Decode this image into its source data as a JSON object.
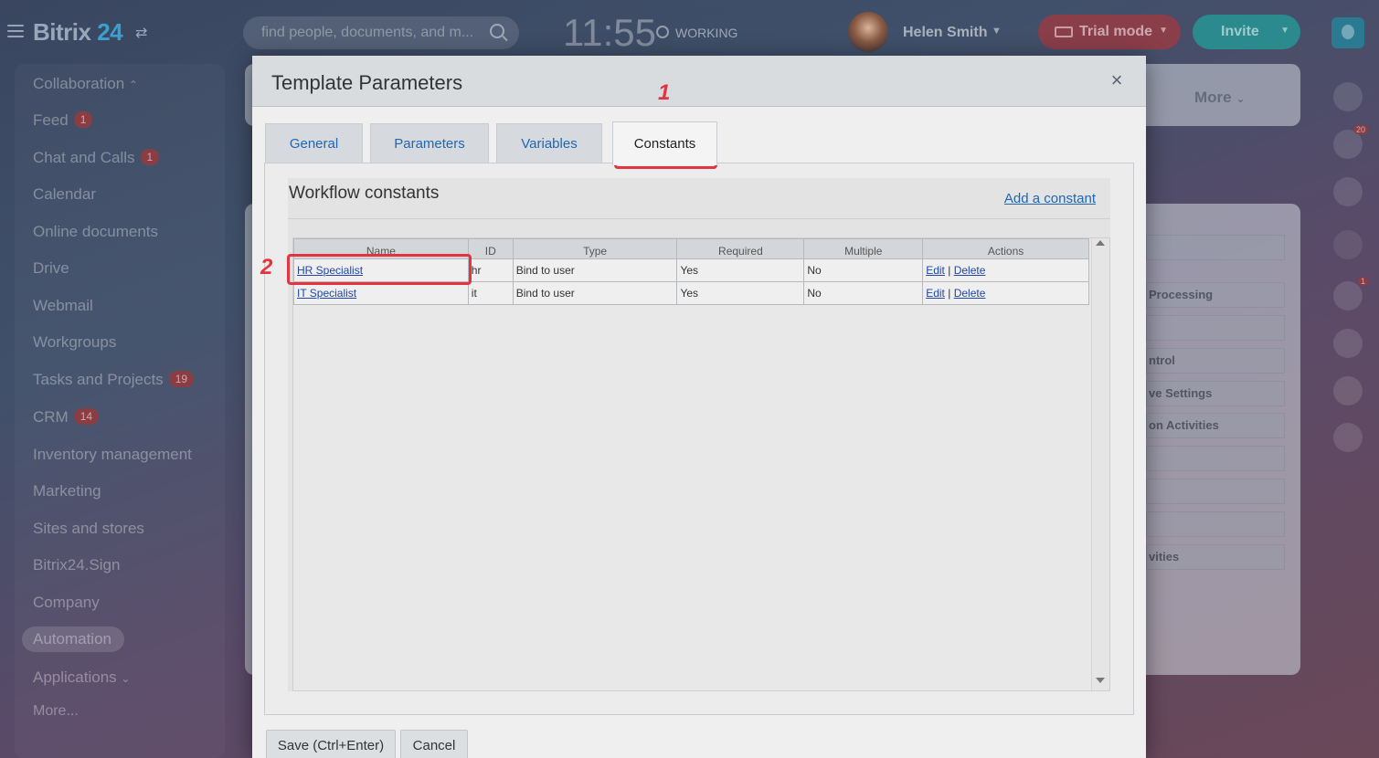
{
  "topbar": {
    "logo_main": "Bitrix",
    "logo_num": "24",
    "search_placeholder": "find people, documents, and m...",
    "clock": "11:55",
    "work_status": "WORKING",
    "user_name": "Helen Smith",
    "trial_label": "Trial mode",
    "invite_label": "Invite"
  },
  "sidebar": {
    "items": [
      {
        "label": "Collaboration",
        "badge": ""
      },
      {
        "label": "Feed",
        "badge": "1"
      },
      {
        "label": "Chat and Calls",
        "badge": "1"
      },
      {
        "label": "Calendar",
        "badge": ""
      },
      {
        "label": "Online documents",
        "badge": ""
      },
      {
        "label": "Drive",
        "badge": ""
      },
      {
        "label": "Webmail",
        "badge": ""
      },
      {
        "label": "Workgroups",
        "badge": ""
      },
      {
        "label": "Tasks and Projects",
        "badge": "19"
      },
      {
        "label": "CRM",
        "badge": "14"
      },
      {
        "label": "Inventory management",
        "badge": ""
      },
      {
        "label": "Marketing",
        "badge": ""
      },
      {
        "label": "Sites and stores",
        "badge": ""
      },
      {
        "label": "Bitrix24.Sign",
        "badge": ""
      },
      {
        "label": "Company",
        "badge": ""
      },
      {
        "label": "Automation",
        "badge": ""
      },
      {
        "label": "Applications",
        "badge": ""
      },
      {
        "label": "More...",
        "badge": ""
      }
    ]
  },
  "background": {
    "more_label": "More",
    "rows": [
      "Processing",
      "",
      "ntrol",
      "ve Settings",
      "on Activities",
      "",
      "",
      "",
      "vities"
    ],
    "notif_badge": "20",
    "rail_badge_1": "1"
  },
  "dialog": {
    "title": "Template Parameters",
    "close_label": "×",
    "tabs": [
      {
        "label": "General"
      },
      {
        "label": "Parameters"
      },
      {
        "label": "Variables"
      },
      {
        "label": "Constants"
      }
    ],
    "section_title": "Workflow constants",
    "add_constant": "Add a constant",
    "columns": [
      "Name",
      "ID",
      "Type",
      "Required",
      "Multiple",
      "Actions"
    ],
    "rows": [
      {
        "name": "HR Specialist",
        "id": "hr",
        "type": "Bind to user",
        "required": "Yes",
        "multiple": "No",
        "edit": "Edit",
        "sep": "|",
        "delete": "Delete"
      },
      {
        "name": "IT Specialist",
        "id": "it",
        "type": "Bind to user",
        "required": "Yes",
        "multiple": "No",
        "edit": "Edit",
        "sep": "|",
        "delete": "Delete"
      }
    ],
    "save_label": "Save (Ctrl+Enter)",
    "cancel_label": "Cancel"
  },
  "annotations": {
    "mark_1": "1",
    "mark_2": "2",
    "color": "#e3343f"
  }
}
